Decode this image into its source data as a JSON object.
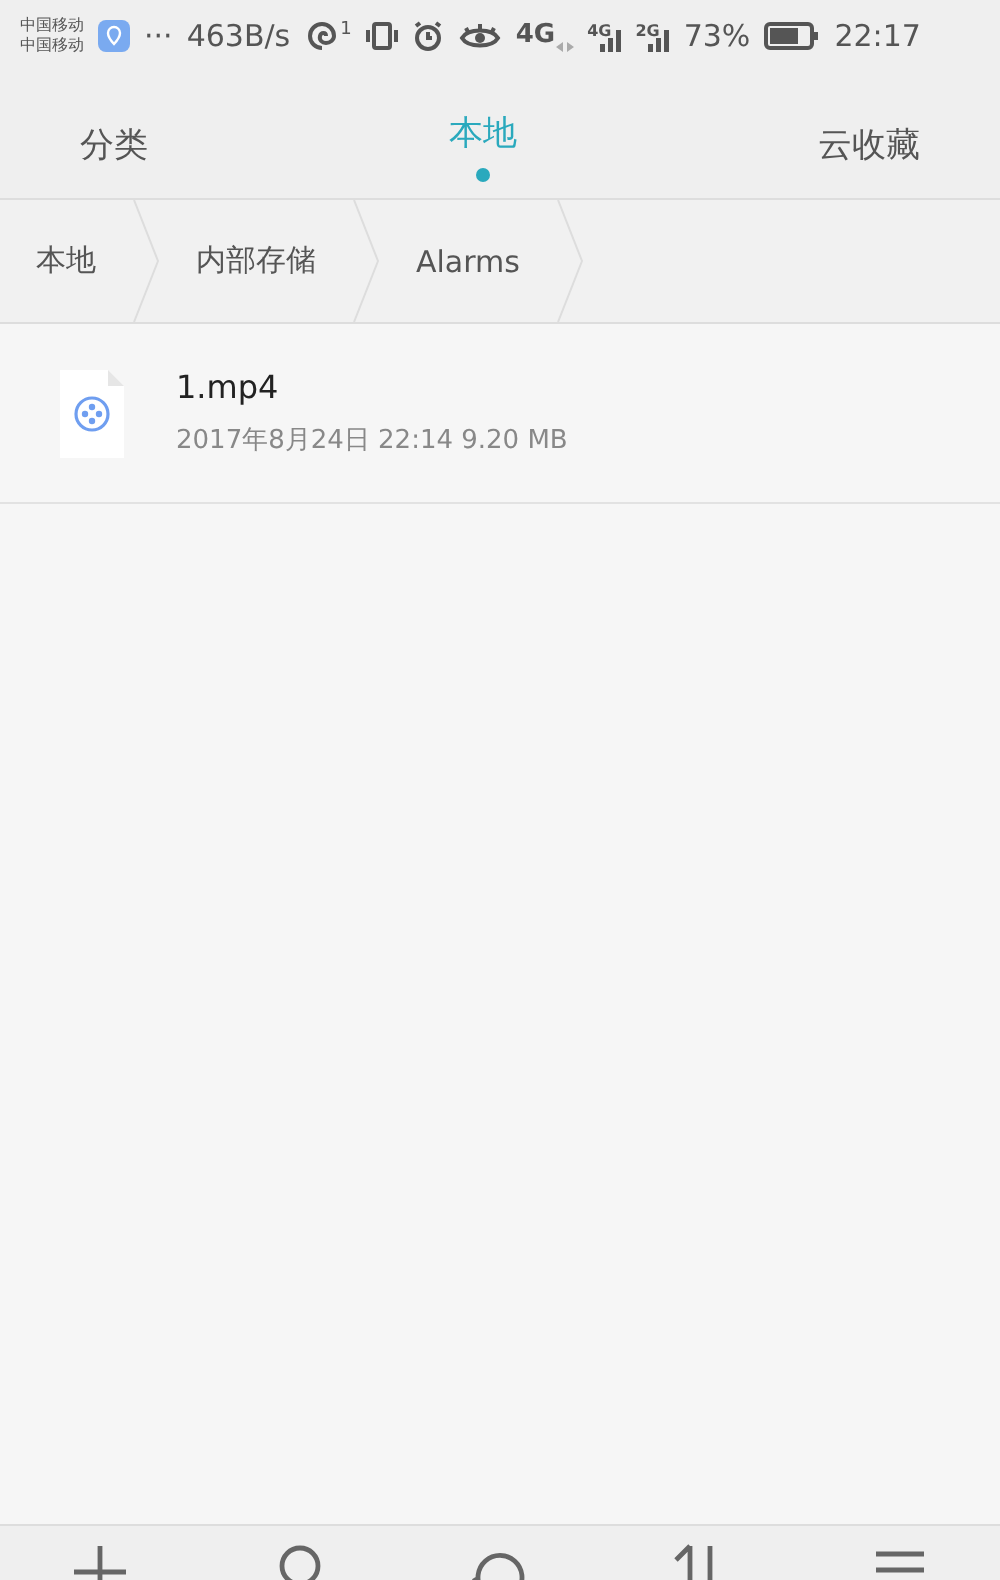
{
  "status_bar": {
    "carriers": [
      "中国移动",
      "中国移动"
    ],
    "more": "···",
    "speed": "463B/s",
    "sync_count": "1",
    "network_labels": [
      "4G",
      "4G",
      "2G"
    ],
    "battery": "73%",
    "time": "22:17"
  },
  "tabs": [
    {
      "label": "分类",
      "selected": false
    },
    {
      "label": "本地",
      "selected": true
    },
    {
      "label": "云收藏",
      "selected": false
    }
  ],
  "breadcrumb": [
    "本地",
    "内部存储",
    "Alarms"
  ],
  "files": [
    {
      "name": "1.mp4",
      "details": "2017年8月24日 22:14 9.20 MB"
    }
  ]
}
